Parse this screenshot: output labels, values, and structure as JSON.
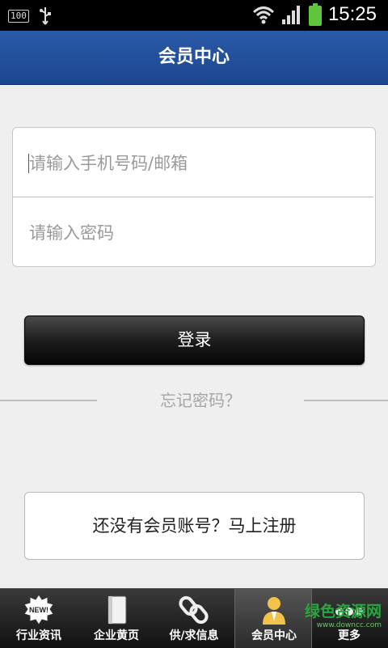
{
  "status_bar": {
    "battery_level": "100",
    "time": "15:25",
    "icons": [
      "usb-icon",
      "wifi-icon",
      "signal-icon",
      "battery-icon"
    ],
    "battery_color": "#5fc53a"
  },
  "header": {
    "title": "会员中心",
    "background": "#2253a0"
  },
  "login_form": {
    "phone_placeholder": "请输入手机号码/邮箱",
    "password_placeholder": "请输入密码",
    "login_label": "登录",
    "forgot_label": "忘记密码？"
  },
  "register": {
    "label": "还没有会员账号？马上注册"
  },
  "tabs": [
    {
      "label": "行业资讯",
      "icon": "new-badge-icon"
    },
    {
      "label": "企业黄页",
      "icon": "book-icon"
    },
    {
      "label": "供/求信息",
      "icon": "chain-link-icon"
    },
    {
      "label": "会员中心",
      "icon": "member-icon",
      "active": true
    },
    {
      "label": "更多",
      "icon": "more-dots-icon"
    }
  ],
  "watermark": {
    "text": "绿色资源网",
    "sub": "www.downcc.com"
  }
}
